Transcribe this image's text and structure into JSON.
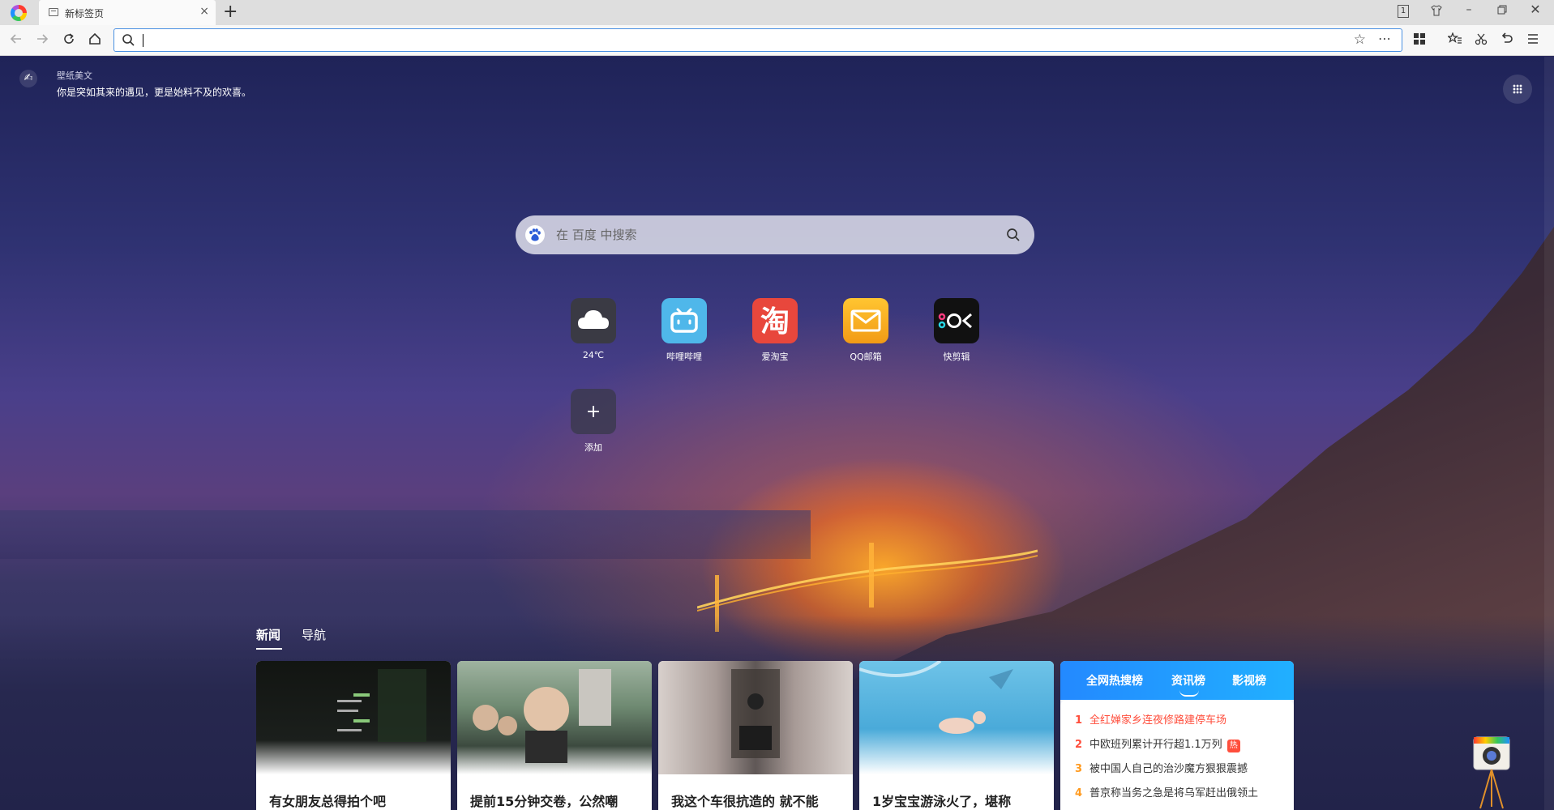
{
  "browser": {
    "tab_title": "新标签页",
    "tab_close": "×",
    "new_tab": "+",
    "window_count": "1"
  },
  "toolbar": {
    "back_icon": "arrow-left-icon",
    "forward_icon": "arrow-right-icon",
    "address_value": "",
    "more_label": "⋯"
  },
  "wallpaper": {
    "label": "壁纸美文",
    "quote": "你是突如其来的遇见，更是始料不及的欢喜。"
  },
  "search": {
    "placeholder": "在 百度 中搜索"
  },
  "shortcuts": [
    {
      "label": "24℃",
      "icon": "cloud-icon",
      "color": "#3a3a44"
    },
    {
      "label": "哔哩哔哩",
      "icon": "bilibili-icon",
      "color": "#4fb7ea"
    },
    {
      "label": "爱淘宝",
      "icon": "taobao-icon",
      "color": "#e8473c"
    },
    {
      "label": "QQ邮箱",
      "icon": "mail-icon",
      "color": "#f5a623"
    },
    {
      "label": "快剪辑",
      "icon": "kuaijianji-icon",
      "color": "#111111"
    },
    {
      "label": "添加",
      "icon": "plus-icon",
      "color": "#3f3d55"
    }
  ],
  "feed_tabs": [
    {
      "label": "新闻"
    },
    {
      "label": "导航"
    }
  ],
  "news": [
    {
      "title": "有女朋友总得拍个吧"
    },
    {
      "title": "提前15分钟交卷，公然嘲"
    },
    {
      "title": "我这个车很抗造的 就不能"
    },
    {
      "title": "1岁宝宝游泳火了，堪称"
    }
  ],
  "hot": {
    "tabs": [
      "全网热搜榜",
      "资讯榜",
      "影视榜"
    ],
    "items": [
      {
        "num": "1",
        "text": "全红婵家乡连夜修路建停车场"
      },
      {
        "num": "2",
        "text": "中欧班列累计开行超1.1万列",
        "badge": "热"
      },
      {
        "num": "3",
        "text": "被中国人自己的治沙魔方狠狠震撼"
      },
      {
        "num": "4",
        "text": "普京称当务之急是将乌军赶出俄领土"
      }
    ]
  }
}
